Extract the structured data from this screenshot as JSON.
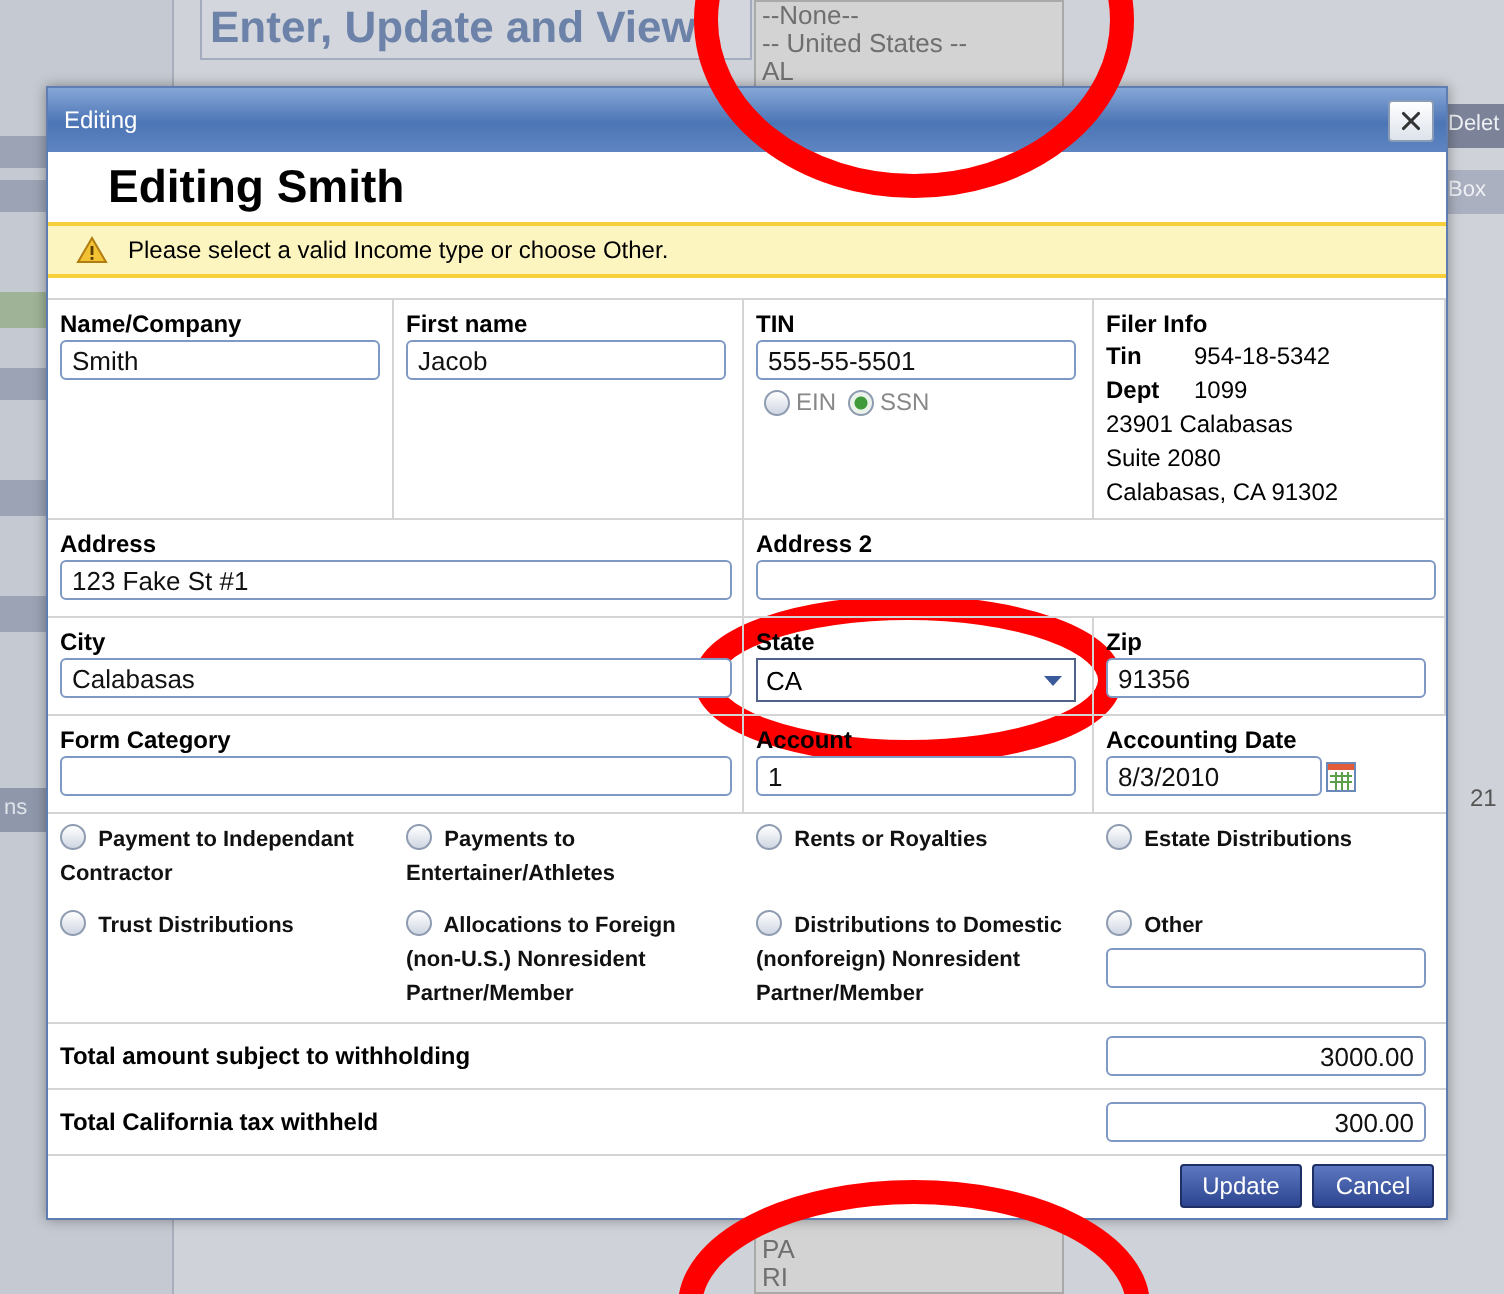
{
  "background": {
    "heading": "Enter, Update and View",
    "list_top": [
      "--None--",
      "-- United States --",
      "AL"
    ],
    "list_bottom": [
      "PA",
      "RI"
    ],
    "right_button": "Delet",
    "right_tab": "Box",
    "right_cell": "21",
    "left_label": "ns"
  },
  "dialog": {
    "title": "Editing",
    "heading": "Editing Smith",
    "warning": "Please select a valid Income type or choose Other.",
    "name_company": {
      "label": "Name/Company",
      "value": "Smith"
    },
    "first_name": {
      "label": "First name",
      "value": "Jacob"
    },
    "tin": {
      "label": "TIN",
      "value": "555-55-5501",
      "types": [
        {
          "label": "EIN",
          "selected": false
        },
        {
          "label": "SSN",
          "selected": true
        }
      ]
    },
    "filer_info": {
      "label": "Filer Info",
      "pairs": [
        {
          "key": "Tin",
          "value": "954-18-5342"
        },
        {
          "key": "Dept",
          "value": "1099"
        }
      ],
      "lines": [
        "23901 Calabasas",
        "Suite 2080",
        "Calabasas, CA 91302"
      ]
    },
    "address": {
      "label": "Address",
      "value": "123 Fake St #1"
    },
    "address_2": {
      "label": "Address 2"
    },
    "city": {
      "label": "City",
      "value": "Calabasas"
    },
    "state": {
      "label": "State",
      "value": "CA"
    },
    "zip": {
      "label": "Zip",
      "value": "91356"
    },
    "form_category": {
      "label": "Form Category"
    },
    "account": {
      "label": "Account",
      "value": "1"
    },
    "accounting_date": {
      "label": "Accounting Date",
      "value": "8/3/2010"
    },
    "income_types": [
      {
        "kind": "plain",
        "label": "Payment to Independant Contractor",
        "selected": false
      },
      {
        "kind": "plain",
        "label": "Payments to Entertainer/Athletes",
        "selected": false
      },
      {
        "kind": "plain",
        "label": "Rents or Royalties",
        "selected": false
      },
      {
        "kind": "plain",
        "label": "Estate Distributions",
        "selected": false
      },
      {
        "kind": "plain",
        "label": "Trust Distributions",
        "selected": false
      },
      {
        "kind": "plain",
        "label": "Allocations to Foreign (non-U.S.) Nonresident Partner/Member",
        "selected": false
      },
      {
        "kind": "plain",
        "label": "Distributions to Domestic (nonforeign) Nonresident Partner/Member",
        "selected": false
      },
      {
        "kind": "other",
        "label": "Other",
        "selected": false
      }
    ],
    "totals": [
      {
        "label": "Total amount subject to withholding",
        "value": "3000.00"
      },
      {
        "label": "Total California tax withheld",
        "value": "300.00"
      }
    ],
    "buttons": [
      {
        "label": "Update"
      },
      {
        "label": "Cancel"
      }
    ]
  }
}
